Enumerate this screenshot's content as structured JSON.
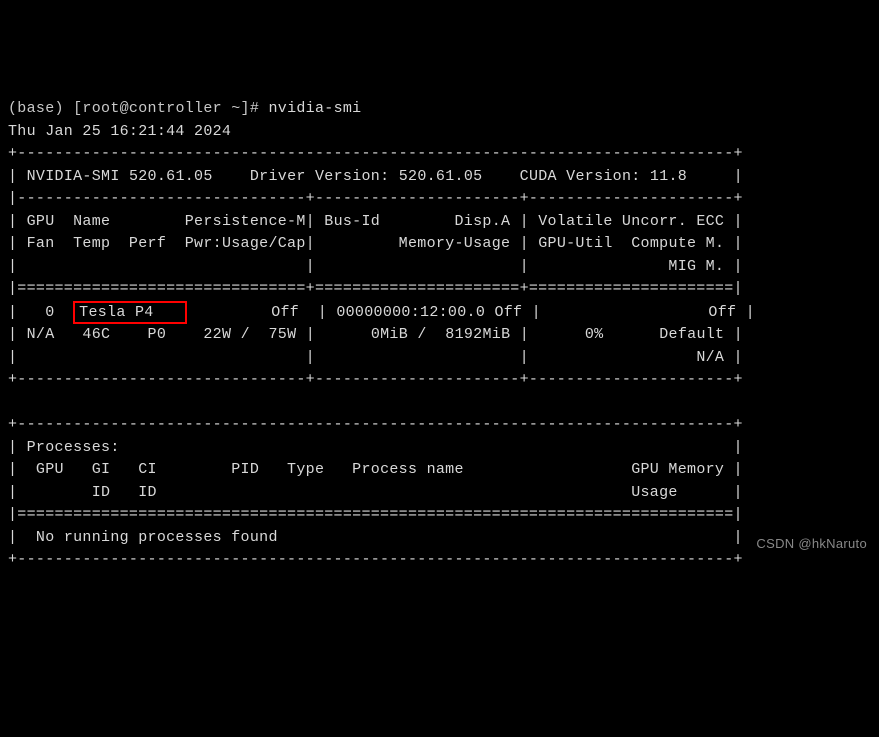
{
  "prompt": {
    "env": "(base)",
    "user_host": "[root@controller ~]#",
    "command": "nvidia-smi"
  },
  "timestamp": "Thu Jan 25 16:21:44 2024",
  "header": {
    "smi_label": "NVIDIA-SMI",
    "smi_version": "520.61.05",
    "driver_label": "Driver Version:",
    "driver_version": "520.61.05",
    "cuda_label": "CUDA Version:",
    "cuda_version": "11.8"
  },
  "columns": {
    "row1_col1": "GPU  Name        Persistence-M",
    "row1_col2": "Bus-Id        Disp.A",
    "row1_col3": "Volatile Uncorr. ECC",
    "row2_col1": "Fan  Temp  Perf  Pwr:Usage/Cap",
    "row2_col2": "         Memory-Usage",
    "row2_col3": "GPU-Util  Compute M.",
    "row3_col3": "MIG M."
  },
  "gpu": {
    "id": "0",
    "name": "Tesla P4",
    "persistence": "Off",
    "bus_id": "00000000:12:00.0",
    "disp_a": "Off",
    "ecc": "Off",
    "fan": "N/A",
    "temp": "46C",
    "perf": "P0",
    "pwr_usage": "22W",
    "pwr_cap": "75W",
    "mem_used": "0MiB",
    "mem_total": "8192MiB",
    "gpu_util": "0%",
    "compute_m": "Default",
    "mig_m": "N/A"
  },
  "processes": {
    "title": "Processes:",
    "header1": "  GPU   GI   CI        PID   Type   Process name                  GPU Memory",
    "header2": "        ID   ID                                                   Usage     ",
    "no_procs": "  No running processes found"
  },
  "watermark": "CSDN @hkNaruto"
}
